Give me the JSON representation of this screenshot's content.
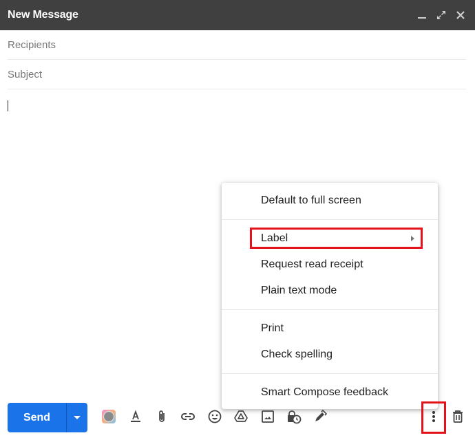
{
  "window": {
    "title": "New Message",
    "controls": [
      {
        "name": "minimize",
        "icon": "minimize-icon"
      },
      {
        "name": "full-screen",
        "icon": "expand-icon"
      },
      {
        "name": "close",
        "icon": "close-icon"
      }
    ]
  },
  "fields": {
    "recipients": {
      "placeholder": "Recipients",
      "value": ""
    },
    "subject": {
      "placeholder": "Subject",
      "value": ""
    }
  },
  "body": {
    "value": ""
  },
  "menu": {
    "items": [
      {
        "label": "Default to full screen"
      },
      {
        "label": "Label",
        "has_submenu": true,
        "highlighted": true
      },
      {
        "label": "Request read receipt"
      },
      {
        "label": "Plain text mode"
      },
      {
        "label": "Print"
      },
      {
        "label": "Check spelling"
      },
      {
        "label": "Smart Compose feedback"
      }
    ]
  },
  "toolbar": {
    "send_label": "Send",
    "tools": [
      {
        "name": "signature-color",
        "icon": "colorful-circle-icon"
      },
      {
        "name": "formatting-options",
        "icon": "text-format-icon"
      },
      {
        "name": "attach-files",
        "icon": "paperclip-icon"
      },
      {
        "name": "insert-link",
        "icon": "link-icon"
      },
      {
        "name": "insert-emoji",
        "icon": "emoji-icon"
      },
      {
        "name": "insert-drive",
        "icon": "drive-icon"
      },
      {
        "name": "insert-photo",
        "icon": "photo-icon"
      },
      {
        "name": "confidential-mode",
        "icon": "lock-clock-icon"
      },
      {
        "name": "insert-signature",
        "icon": "pen-icon"
      },
      {
        "name": "more-options",
        "icon": "more-vert-icon"
      },
      {
        "name": "discard-draft",
        "icon": "trash-icon"
      }
    ]
  },
  "colors": {
    "titlebar": "#404040",
    "send": "#1a73e8",
    "highlight": "#e3121b"
  }
}
